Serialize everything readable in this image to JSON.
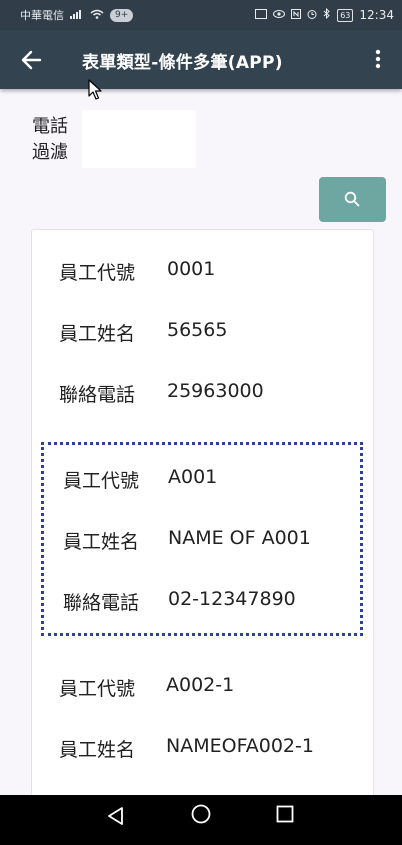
{
  "status_bar": {
    "carrier": "中華電信",
    "notification_count": "9+",
    "battery": "63",
    "time": "12:34"
  },
  "app_bar": {
    "title": "表單類型-條件多筆(APP)"
  },
  "filter": {
    "label_line1": "電話",
    "label_line2": "過濾",
    "value": ""
  },
  "records": [
    {
      "id_label": "員工代號",
      "id": "0001",
      "name_label": "員工姓名",
      "name": "56565",
      "phone_label": "聯絡電話",
      "phone": "25963000"
    },
    {
      "id_label": "員工代號",
      "id": "A001",
      "name_label": "員工姓名",
      "name": "NAME OF A001",
      "phone_label": "聯絡電話",
      "phone": "02-12347890"
    },
    {
      "id_label": "員工代號",
      "id": "A002-1",
      "name_label": "員工姓名",
      "name": "NAMEOFA002-1"
    }
  ],
  "colors": {
    "app_bar": "#344350",
    "status_bar": "#313d48",
    "search_button": "#6ea6a1",
    "selection_border": "#2f3f9e"
  }
}
